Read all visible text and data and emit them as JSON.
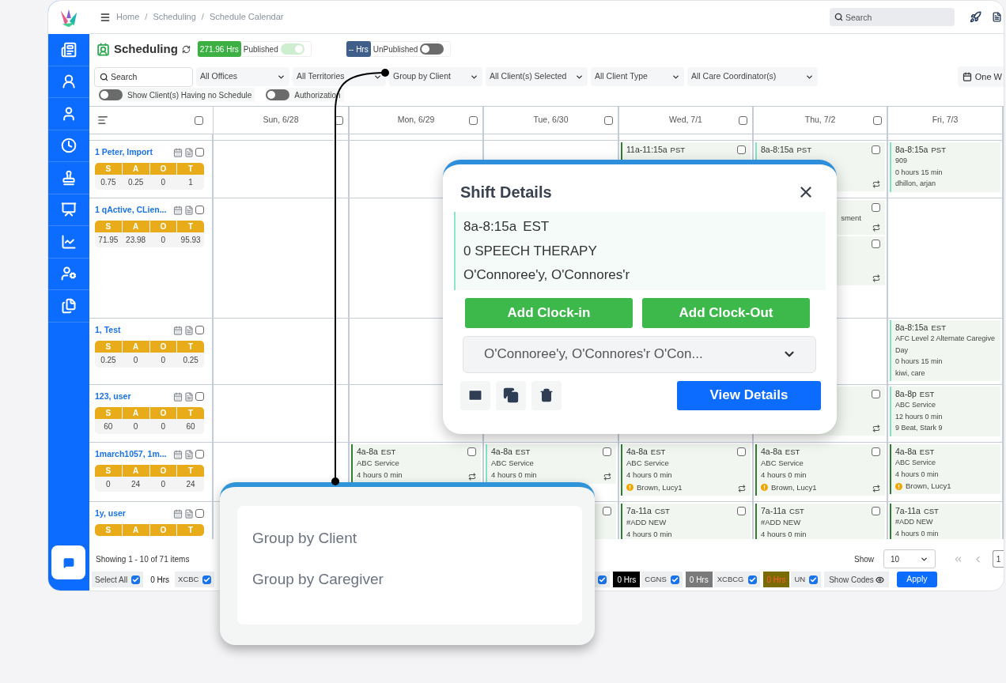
{
  "header": {
    "breadcrumbs": [
      {
        "kind": "link",
        "text": "Home"
      },
      {
        "kind": "separator",
        "text": "/"
      },
      {
        "kind": "link",
        "text": "Scheduling"
      },
      {
        "kind": "separator",
        "text": "/"
      },
      {
        "kind": "link",
        "text": "Schedule Calendar"
      }
    ],
    "search": {
      "placeholder": "Search"
    }
  },
  "page": {
    "title": "Scheduling",
    "statuses": [
      {
        "hours": "271.96 Hrs",
        "label": "Published",
        "on": true,
        "color": "#3cb043"
      },
      {
        "hours": "-- Hrs",
        "label": "UnPublished",
        "on": false,
        "color": "#3f5f8a"
      }
    ]
  },
  "filters": {
    "search": {
      "placeholder": "Search"
    },
    "dropdowns": [
      "All Offices",
      "All Territories",
      "Group by Client",
      "All Client(s) Selected",
      "All Client Type",
      "All Care Coordinator(s)"
    ],
    "toggles": [
      {
        "label": "Show Client(s) Having no Schedule",
        "on": false
      },
      {
        "label": "Authorization",
        "on": false
      }
    ],
    "range": "One W"
  },
  "calendar": {
    "all_checked": false,
    "columns": [
      {
        "label": "Sun, 6/28",
        "checked": false
      },
      {
        "label": "Mon, 6/29",
        "checked": false
      },
      {
        "label": "Tue, 6/30",
        "checked": false
      },
      {
        "label": "Wed, 7/1",
        "checked": false
      },
      {
        "label": "Thu, 7/2",
        "checked": false
      },
      {
        "label": "Fri, 7/3"
      }
    ],
    "rows": [
      {
        "client": "1 Peter, Import",
        "checked": false,
        "summary": [
          {
            "label": "S",
            "value": "0.75"
          },
          {
            "label": "A",
            "value": "0.25"
          },
          {
            "label": "O",
            "value": "0"
          },
          {
            "label": "T",
            "value": "1"
          }
        ],
        "cells": [
          [],
          [],
          [],
          [
            {
              "time": "11a-11:15a",
              "tz": "PST",
              "color": "#2e7d32",
              "checked": false
            }
          ],
          [
            {
              "time": "8a-8:15a",
              "tz": "PST",
              "color": "#7fe3c4",
              "checked": false,
              "repeat": true
            }
          ],
          [
            {
              "time": "8a-8:15a",
              "tz": "PST",
              "color": "#7fe3c4",
              "lines": [
                "909",
                "0 hours 15 min",
                "dhillon, arjan"
              ]
            }
          ]
        ]
      },
      {
        "client": "1 qActive, CLien...",
        "checked": false,
        "summary": [
          {
            "label": "S",
            "value": "71.95"
          },
          {
            "label": "A",
            "value": "23.98"
          },
          {
            "label": "O",
            "value": "0"
          },
          {
            "label": "T",
            "value": "95.93"
          }
        ],
        "cells": [
          [],
          [],
          [],
          [],
          [
            {
              "checked": false,
              "lines": [
                "sment"
              ],
              "repeat": true
            },
            {
              "checked": false,
              "repeat": true
            }
          ],
          []
        ]
      },
      {
        "client": "1, Test",
        "checked": false,
        "summary": [
          {
            "label": "S",
            "value": "0.25"
          },
          {
            "label": "A",
            "value": "0"
          },
          {
            "label": "O",
            "value": "0"
          },
          {
            "label": "T",
            "value": "0.25"
          }
        ],
        "cells": [
          [],
          [],
          [],
          [],
          [],
          [
            {
              "time": "8a-8:15a",
              "tz": "EST",
              "color": "#7fe3c4",
              "lines": [
                "AFC Level 2 Alternate Caregive",
                "Day",
                "0 hours 15 min",
                "kiwi, care"
              ]
            }
          ]
        ]
      },
      {
        "client": "123, user",
        "checked": false,
        "summary": [
          {
            "label": "S",
            "value": "60"
          },
          {
            "label": "A",
            "value": "0"
          },
          {
            "label": "O",
            "value": "0"
          },
          {
            "label": "T",
            "value": "60"
          }
        ],
        "cells": [
          [],
          [],
          [],
          [],
          [
            {
              "checked": false,
              "repeat": true
            }
          ],
          [
            {
              "time": "8a-8p",
              "tz": "EST",
              "color": "#7fe3c4",
              "lines": [
                "ABC Service",
                "12 hours 0 min",
                "9 Beat, Stark 9"
              ]
            }
          ]
        ]
      },
      {
        "client": "1march1057, 1m...",
        "checked": false,
        "summary": [
          {
            "label": "S",
            "value": "0"
          },
          {
            "label": "A",
            "value": "24"
          },
          {
            "label": "O",
            "value": "0"
          },
          {
            "label": "T",
            "value": "24"
          }
        ],
        "cells": [
          [],
          [
            {
              "time": "4a-8a",
              "tz": "EST",
              "color": "#2e7d32",
              "checked": false,
              "repeat": true,
              "lines": [
                "ABC Service",
                "4 hours 0 min"
              ]
            }
          ],
          [
            {
              "time": "4a-8a",
              "tz": "EST",
              "color": "#7fe3c4",
              "checked": false,
              "repeat": true,
              "lines": [
                "ABC Service",
                "4 hours 0 min"
              ]
            }
          ],
          [
            {
              "time": "4a-8a",
              "tz": "EST",
              "color": "#2e7d32",
              "checked": false,
              "repeat": true,
              "lines": [
                "ABC Service",
                "4 hours 0 min"
              ],
              "caregiver": "Brown, Lucy1",
              "warning": true
            }
          ],
          [
            {
              "time": "4a-8a",
              "tz": "EST",
              "color": "#2e7d32",
              "checked": false,
              "repeat": true,
              "lines": [
                "ABC Service",
                "4 hours 0 min"
              ],
              "caregiver": "Brown, Lucy1",
              "warning": true
            }
          ],
          [
            {
              "time": "4a-8a",
              "tz": "EST",
              "color": "#2e7d32",
              "lines": [
                "ABC Service",
                "4 hours 0 min"
              ],
              "caregiver": "Brown, Lucy1",
              "warning": true
            }
          ]
        ]
      },
      {
        "client": "1y, user",
        "checked": false,
        "summary": [
          {
            "label": "S"
          },
          {
            "label": "A"
          },
          {
            "label": "O"
          },
          {
            "label": "T"
          }
        ],
        "cells": [
          [],
          [],
          [
            {
              "checked": false
            }
          ],
          [
            {
              "time": "7a-11a",
              "tz": "CST",
              "color": "#2e7d32",
              "checked": false,
              "lines": [
                "#ADD NEW",
                "4 hours 0 min"
              ]
            }
          ],
          [
            {
              "time": "7a-11a",
              "tz": "CST",
              "color": "#2e7d32",
              "checked": false,
              "lines": [
                "#ADD NEW",
                "4 hours 0 min"
              ]
            }
          ],
          [
            {
              "time": "7a-11a",
              "tz": "CST",
              "color": "#2e7d32",
              "lines": [
                "#ADD NEW",
                "4 hours 0 min"
              ]
            }
          ]
        ]
      }
    ]
  },
  "footer": {
    "summary": "Showing 1 - 10 of 71 items",
    "show_label": "Show",
    "page_size": "10",
    "page": "1",
    "select_all": {
      "label": "Select All",
      "checked": true
    },
    "codes": [
      {
        "hours": "0 Hrs",
        "code": "XCBC",
        "checked": true,
        "color": "#ffffff"
      },
      {
        "checked": true
      },
      {
        "hours": "0 Hrs",
        "code": "CGNS",
        "checked": true,
        "color": "#000000"
      },
      {
        "hours": "0 Hrs",
        "code": "XCBCG",
        "checked": true,
        "color": "#7a7a7a"
      },
      {
        "hours": "0 Hrs",
        "code": "UN",
        "checked": true,
        "color": "#7a6c00"
      }
    ],
    "show_codes": "Show Codes",
    "apply": "Apply"
  },
  "shift_details": {
    "title": "Shift Details",
    "time": "8a-8:15a",
    "tz": "EST",
    "service": "0 SPEECH THERAPY",
    "caregiver": "O'Connoree'y, O'Connores'r",
    "actions": [
      "Add Clock-in",
      "Add Clock-Out"
    ],
    "select": "O'Connoree'y, O'Connores'r O'Con...",
    "view": "View Details"
  },
  "group_menu": {
    "items": [
      {
        "label": "Group by Client",
        "selected": false
      },
      {
        "label": "Group by Caregiver",
        "selected": false
      }
    ]
  }
}
